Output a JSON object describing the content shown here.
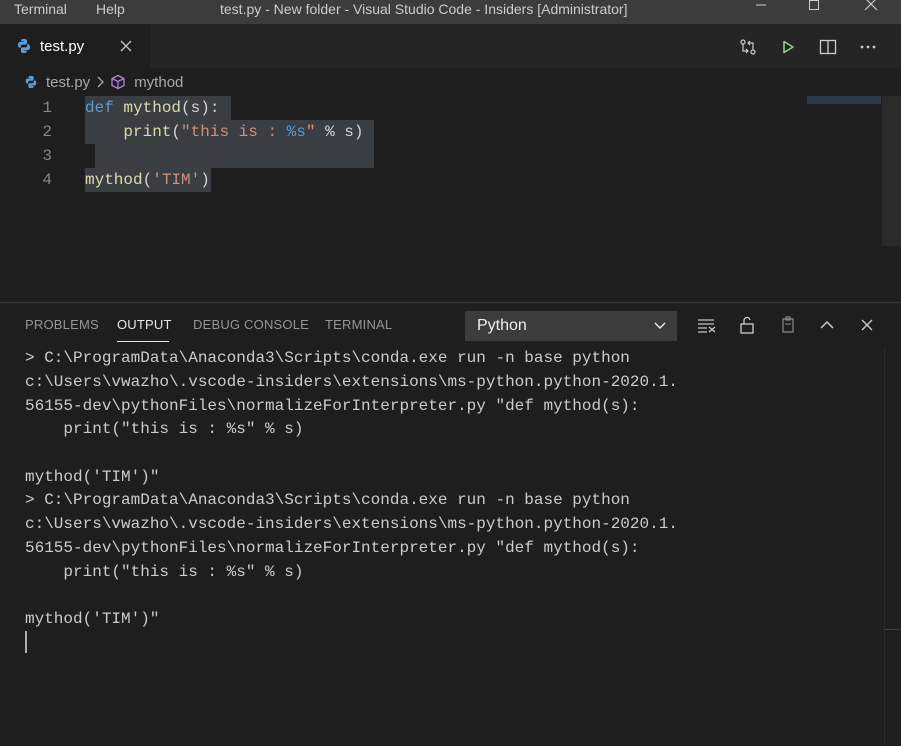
{
  "menu": {
    "terminal": "Terminal",
    "help": "Help"
  },
  "window": {
    "title": "test.py - New folder - Visual Studio Code - Insiders [Administrator]"
  },
  "tab": {
    "label": "test.py",
    "close": "✕"
  },
  "breadcrumb": {
    "file": "test.py",
    "symbol": "mythod"
  },
  "editor": {
    "line_numbers": [
      "1",
      "2",
      "3",
      "4"
    ],
    "l1": {
      "kw": "def",
      "fn": "mythod",
      "rest": "(s):"
    },
    "l2": {
      "indent": "    ",
      "fn": "print",
      "open": "(",
      "str": "\"this is : ",
      "fmt": "%s",
      "strend": "\"",
      "rest": " % s)"
    },
    "l4": {
      "fn": "mythod",
      "open": "(",
      "str": "'TIM'",
      "rest": ")"
    }
  },
  "panel": {
    "tabs": [
      "PROBLEMS",
      "OUTPUT",
      "DEBUG CONSOLE",
      "TERMINAL"
    ],
    "dropdown_value": "Python"
  },
  "output": {
    "lines": [
      "> C:\\ProgramData\\Anaconda3\\Scripts\\conda.exe run -n base python",
      "c:\\Users\\vwazho\\.vscode-insiders\\extensions\\ms-python.python-2020.1.",
      "56155-dev\\pythonFiles\\normalizeForInterpreter.py \"def mythod(s):",
      "    print(\"this is : %s\" % s)",
      "",
      "mythod('TIM')\"",
      "> C:\\ProgramData\\Anaconda3\\Scripts\\conda.exe run -n base python",
      "c:\\Users\\vwazho\\.vscode-insiders\\extensions\\ms-python.python-2020.1.",
      "56155-dev\\pythonFiles\\normalizeForInterpreter.py \"def mythod(s):",
      "    print(\"this is : %s\" % s)",
      "",
      "mythod('TIM')\""
    ]
  },
  "colors": {
    "accent": "#007acc",
    "run": "#89d185",
    "keyword": "#569cd6",
    "function": "#dcdcaa",
    "string": "#ce9178"
  }
}
